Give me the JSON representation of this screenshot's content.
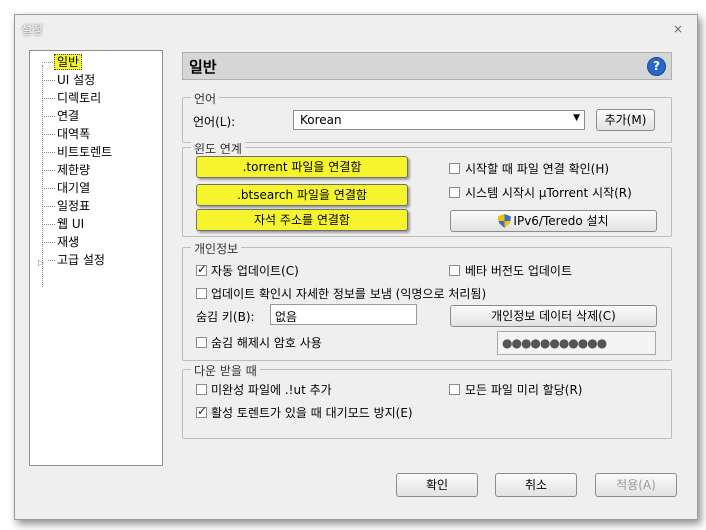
{
  "window": {
    "title": "설정",
    "close_icon": "×"
  },
  "tree": {
    "items": [
      {
        "label": "일반"
      },
      {
        "label": "UI 설정"
      },
      {
        "label": "디렉토리"
      },
      {
        "label": "연결"
      },
      {
        "label": "대역폭"
      },
      {
        "label": "비트토렌트"
      },
      {
        "label": "제한량"
      },
      {
        "label": "대기열"
      },
      {
        "label": "일정표"
      },
      {
        "label": "웹 UI"
      },
      {
        "label": "재생"
      },
      {
        "label": "고급 설정"
      }
    ],
    "selected": "일반",
    "highlight_color": "#f5f52a"
  },
  "header": {
    "title": "일반",
    "help_icon": "?"
  },
  "language": {
    "group_title": "언어",
    "label": "언어(L):",
    "selected": "Korean",
    "add_button": "추가(M)"
  },
  "windows_integration": {
    "group_title": "윈도 연계",
    "btn_torrent": ".torrent 파일을 연결함",
    "btn_btsearch": ".btsearch 파일을 연결함",
    "btn_magnet": "자석 주소를 연결함",
    "check_startup_assoc": "시작할 때 파일 연결 확인(H)",
    "check_start_on_boot": "시스템 시작시 µTorrent 시작(R)",
    "btn_ipv6": "IPv6/Teredo 설치",
    "button_color": "#f6f42c"
  },
  "privacy": {
    "group_title": "개인정보",
    "check_auto_update": "자동 업데이트(C)",
    "check_beta": "베타 버전도 업데이트",
    "check_send_info": "업데이트 확인시 자세한 정보를 보냄 (익명으로 처리됨)",
    "boss_key_label": "숨김 키(B):",
    "boss_key_value": "없음",
    "btn_clear_private": "개인정보 데이터 삭제(C)",
    "check_unhide_password": "숨김 해제시 암호 사용",
    "password_mask": "●●●●●●●●●●●"
  },
  "downloading": {
    "group_title": "다운 받을 때",
    "check_append_ut": "미완성 파일에 .!ut 추가",
    "check_preallocate": "모든 파일 미리 할당(R)",
    "check_prevent_standby": "활성 토렌트가 있을 때 대기모드 방지(E)"
  },
  "footer": {
    "ok": "확인",
    "cancel": "취소",
    "apply": "적용(A)"
  }
}
